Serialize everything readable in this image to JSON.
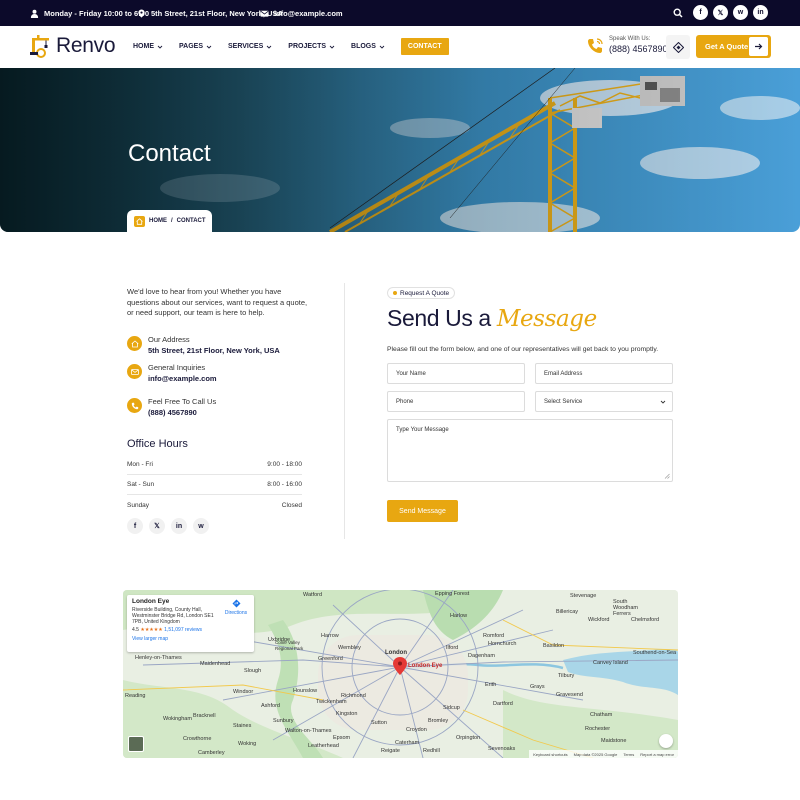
{
  "topbar": {
    "hours": "Monday - Friday 10:00 to 6:00",
    "address": "5th Street, 21st Floor, New York, USA",
    "email": "info@example.com",
    "social": [
      "f",
      "𝕏",
      "w",
      "in"
    ]
  },
  "header": {
    "logo_text": "Renvo",
    "nav": [
      "HOME",
      "PAGES",
      "SERVICES",
      "PROJECTS",
      "BLOGS",
      "CONTACT"
    ],
    "speak_label": "Speak With Us:",
    "phone": "(888) 4567890",
    "quote_button": "Get A Quote"
  },
  "hero": {
    "title": "Contact",
    "breadcrumb_home": "HOME",
    "breadcrumb_sep": "/",
    "breadcrumb_current": "CONTACT"
  },
  "info": {
    "intro": "We'd love to hear from you! Whether you have questions about our services, want to request a quote, or need support, our team is here to help.",
    "items": [
      {
        "label": "Our Address",
        "value": "5th Street, 21st Floor, New York, USA"
      },
      {
        "label": "General Inquiries",
        "value": "info@example.com"
      },
      {
        "label": "Feel Free To Call Us",
        "value": "(888) 4567890"
      }
    ],
    "hours_title": "Office Hours",
    "hours": [
      {
        "day": "Mon - Fri",
        "time": "9:00 - 18:00"
      },
      {
        "day": "Sat - Sun",
        "time": "8:00 - 16:00"
      },
      {
        "day": "Sunday",
        "time": "Closed"
      }
    ],
    "social": [
      "f",
      "𝕏",
      "in",
      "w"
    ]
  },
  "form": {
    "badge": "Request A Quote",
    "title_main": "Send Us a",
    "title_accent": "Message",
    "subtitle": "Please fill out the form below, and one of our representatives will get back to you promptly.",
    "name_placeholder": "Your Name",
    "email_placeholder": "Email Address",
    "phone_placeholder": "Phone",
    "service_selected": "Select Service",
    "message_placeholder": "Type Your Message",
    "submit": "Send Message"
  },
  "map": {
    "place_title": "London Eye",
    "place_address": "Riverside Building, County Hall, Westminster Bridge Rd, London SE1 7PB, United Kingdom",
    "rating": "4.5",
    "stars": "★★★★★",
    "reviews": "1,51,097 reviews",
    "larger_map": "View larger map",
    "directions": "Directions",
    "pin_label": "London Eye",
    "places": [
      "Watford",
      "Epping Forest",
      "Stevenage",
      "South Woodham Ferrers",
      "Billericay",
      "Wickford",
      "Chelmsford",
      "Harlow",
      "Harrow",
      "Romford",
      "Hornchurch",
      "Basildon",
      "Southend-on-Sea",
      "Canvey Island",
      "Uxbridge",
      "Colne Valley Regional Park",
      "Wembley",
      "Greenford",
      "London",
      "Dagenham",
      "Ilford",
      "Grays",
      "Slough",
      "Maidenhead",
      "Hounslow",
      "Twickenham",
      "Richmond",
      "Croydon",
      "Dartford",
      "Gravesend",
      "Kingston",
      "Sutton",
      "Epsom",
      "Leatherhead",
      "Orpington",
      "Sevenoaks",
      "Bracknell",
      "Wokingham",
      "Reading",
      "Crowthorne",
      "Camberley",
      "Henley-on-Thames",
      "Windsor",
      "Walton-on-Thames",
      "Ashford",
      "Woking",
      "Chatham",
      "Rochester",
      "Maidstone",
      "Tilbury",
      "Erith",
      "Sidcup",
      "Bromley",
      "Caterham",
      "Redhill",
      "Reigate",
      "Sunbury",
      "Staines"
    ],
    "footer_shortcuts": "Keyboard shortcuts",
    "footer_data": "Map data ©2025 Google",
    "footer_terms": "Terms",
    "footer_report": "Report a map error"
  },
  "colors": {
    "accent": "#e8a711",
    "dark": "#0c0a2a"
  }
}
